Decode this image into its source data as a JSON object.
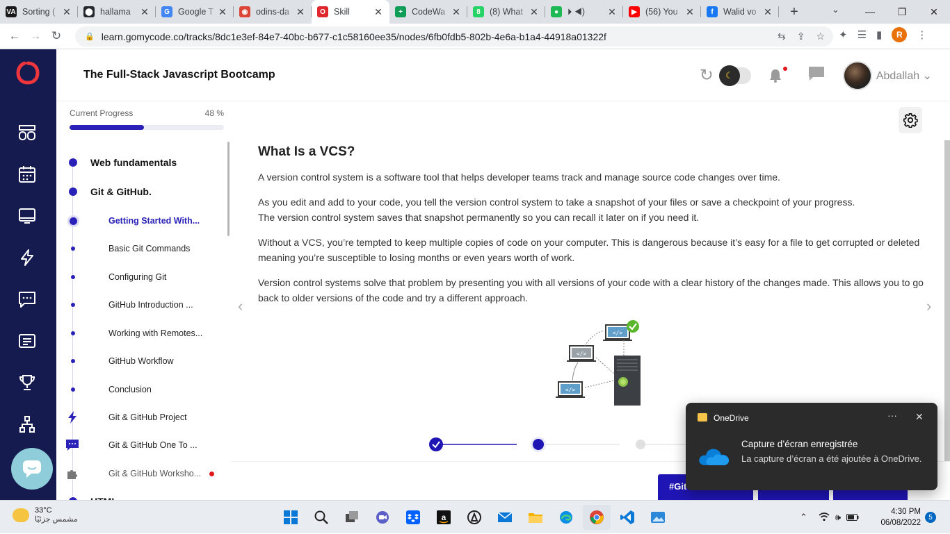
{
  "browser": {
    "tabs": [
      {
        "title": "Sorting (",
        "fav_color": "#1a1a1a",
        "fav_text": "VA"
      },
      {
        "title": "hallama",
        "fav_color": "#24292f",
        "fav_text": "⬤"
      },
      {
        "title": "Google T",
        "fav_color": "#4285f4",
        "fav_text": "G"
      },
      {
        "title": "odins-da",
        "fav_color": "#db4437",
        "fav_text": "◉"
      },
      {
        "title": "Skill",
        "fav_color": "#e0272e",
        "fav_text": "O",
        "active": true
      },
      {
        "title": "CodeWa",
        "fav_color": "#0f9d58",
        "fav_text": "+"
      },
      {
        "title": "(8) What",
        "fav_color": "#25d366",
        "fav_text": "8"
      },
      {
        "title": "⏵ ◀)",
        "fav_color": "#1db954",
        "fav_text": "●"
      },
      {
        "title": "(56) You",
        "fav_color": "#ff0000",
        "fav_text": "▶"
      },
      {
        "title": "Walid vo",
        "fav_color": "#1877f2",
        "fav_text": "f"
      }
    ],
    "url": "learn.gomycode.co/tracks/8dc1e3ef-84e7-40bc-b677-c1c58160ee35/nodes/6fb0fdb5-802b-4e6a-b1a4-44918a01322f",
    "profile_letter": "R"
  },
  "header": {
    "course_title": "The Full-Stack Javascript Bootcamp",
    "username": "Abdallah"
  },
  "sidebar": {
    "progress_label": "Current Progress",
    "progress_pct": "48 %",
    "progress_value": 48,
    "items": [
      {
        "label": "Web fundamentals",
        "level": 0
      },
      {
        "label": "Git & GitHub.",
        "level": 0
      },
      {
        "label": "Getting Started With...",
        "level": 1,
        "active": true
      },
      {
        "label": "Basic Git Commands",
        "level": 1
      },
      {
        "label": "Configuring Git",
        "level": 1
      },
      {
        "label": "GitHub Introduction ...",
        "level": 1
      },
      {
        "label": "Working with Remotes...",
        "level": 1
      },
      {
        "label": "GitHub Workflow",
        "level": 1
      },
      {
        "label": "Conclusion",
        "level": 1
      },
      {
        "label": "Git & GitHub Project",
        "level": 1,
        "icon": "lightning-icon"
      },
      {
        "label": "Git & GitHub One To ...",
        "level": 1,
        "icon": "chat-icon"
      },
      {
        "label": "Git & GitHub Worksho...",
        "level": 1,
        "icon": "puzzle-icon"
      },
      {
        "label": "HTML",
        "level": 0
      }
    ]
  },
  "lesson": {
    "title": "What Is a VCS?",
    "paragraphs": [
      "A version control system is a software tool that helps developer teams track and manage source code changes over time.",
      "As you edit and add to your code, you tell the version control system to take a snapshot of your files or save a checkpoint of your progress.",
      "The version control system saves that snapshot permanently so you can recall it later on if you need it.",
      "Without a VCS, you’re tempted to keep multiple copies of code on your computer. This is dangerous because it’s easy for a file to get corrupted or deleted meaning you’re susceptible to losing months or even years worth of work.",
      "Version control systems solve that problem by presenting you with all versions of your code with a clear history of the changes made. This allows you to go back to older versions of the code and try a different approach."
    ],
    "illustration_code_label": "</>",
    "bottom_button": "#Git"
  },
  "toast": {
    "app": "OneDrive",
    "title": "Capture d’écran enregistrée",
    "body": "La capture d’écran a été ajoutée à OneDrive."
  },
  "taskbar": {
    "temperature": "33°C",
    "condition": "مشمس جزئيًا",
    "time": "4:30 PM",
    "date": "06/08/2022",
    "notifications": "5"
  },
  "colors": {
    "accent": "#2a22b8",
    "rail": "#151a4f",
    "brand_red": "#e0272e"
  }
}
